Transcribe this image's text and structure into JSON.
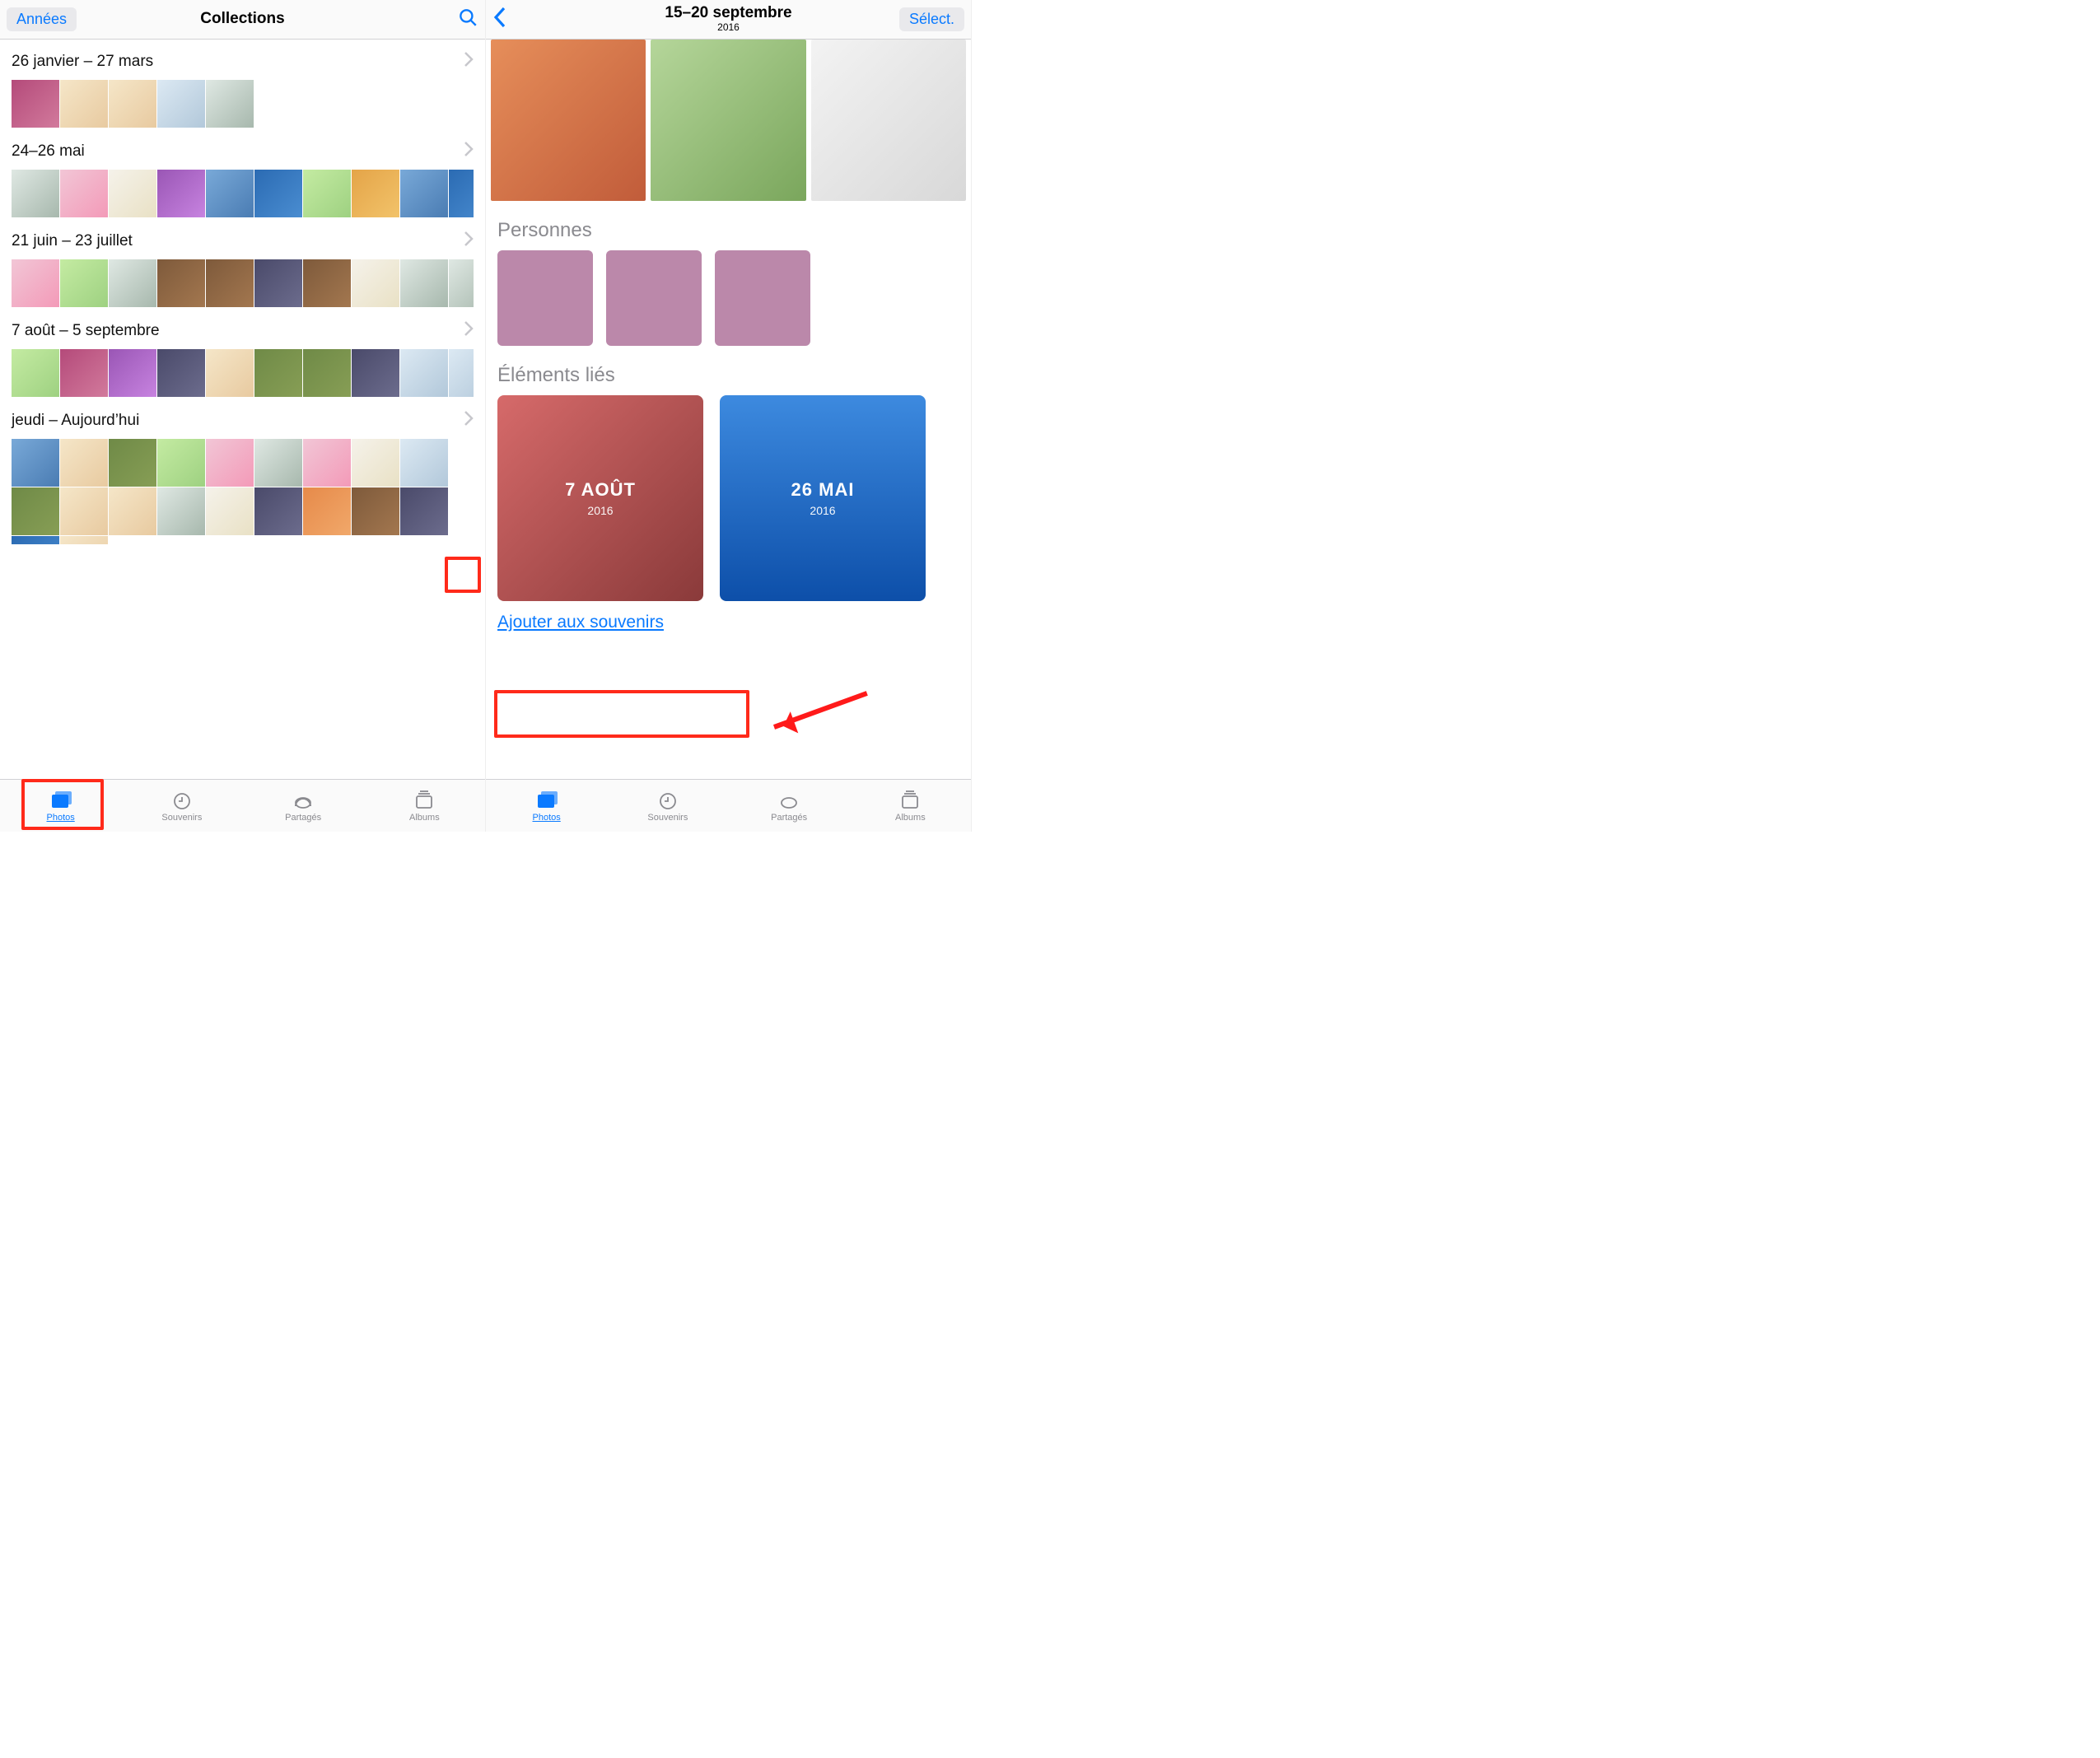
{
  "left": {
    "back_label": "Années",
    "title": "Collections",
    "sections": [
      {
        "title": "26 janvier – 27 mars"
      },
      {
        "title": "24–26 mai"
      },
      {
        "title": "21 juin – 23 juillet"
      },
      {
        "title": "7 août – 5 septembre"
      },
      {
        "title": "jeudi – Aujourd’hui"
      }
    ]
  },
  "right": {
    "title": "15–20 septembre",
    "subtitle": "2016",
    "select_label": "Sélect.",
    "people_label": "Personnes",
    "related_label": "Éléments liés",
    "memories": [
      {
        "title": "7 AOÛT",
        "year": "2016"
      },
      {
        "title": "26 MAI",
        "year": "2016"
      }
    ],
    "add_memories_label": "Ajouter aux souvenirs"
  },
  "tabs": {
    "photos": "Photos",
    "memories": "Souvenirs",
    "shared": "Partagés",
    "albums": "Albums"
  },
  "colors": {
    "accent": "#0a7aff",
    "highlight": "#ff2a1a"
  }
}
